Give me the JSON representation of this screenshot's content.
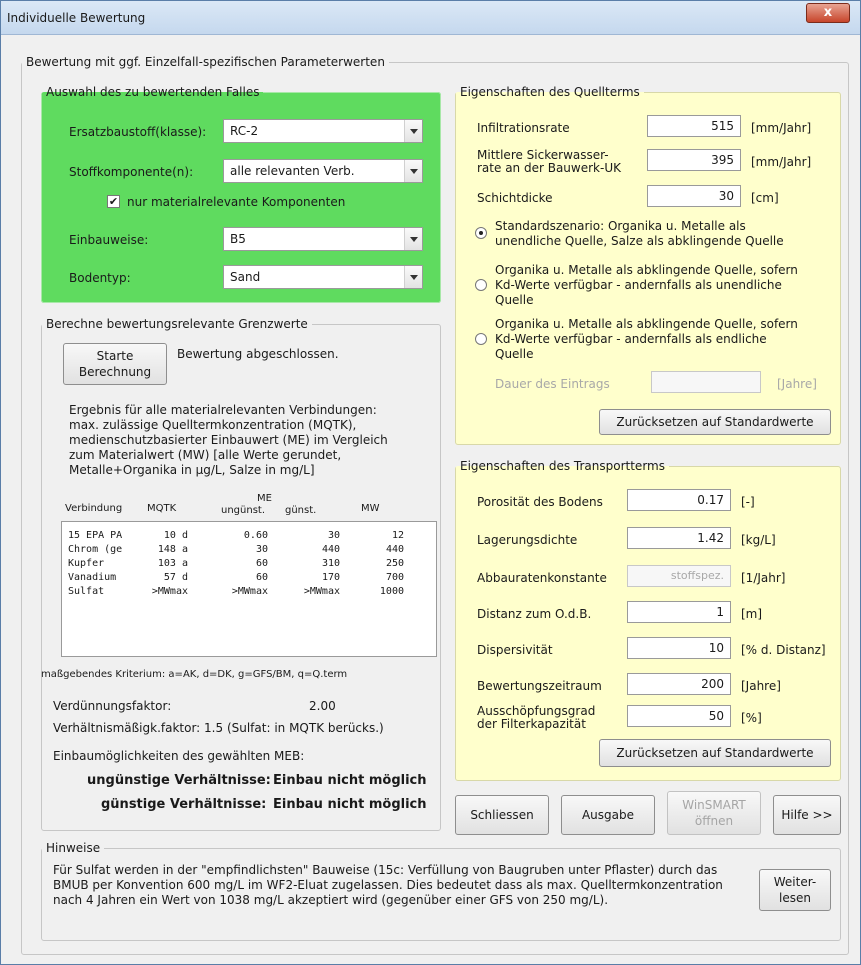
{
  "window": {
    "title": "Individuelle Bewertung",
    "close": "x"
  },
  "main_group": {
    "legend": "Bewertung mit ggf. Einzelfall-spezifischen Parameterwerten"
  },
  "case": {
    "legend": "Auswahl des zu bewertenden Falles",
    "material_label": "Ersatzbaustoff(klasse):",
    "material_value": "RC-2",
    "component_label": "Stoffkomponente(n):",
    "component_value": "alle relevanten Verb.",
    "only_relevant_label": "nur materialrelevante Komponenten",
    "only_relevant_checked": true,
    "install_label": "Einbauweise:",
    "install_value": "B5",
    "soil_label": "Bodentyp:",
    "soil_value": "Sand"
  },
  "calc": {
    "legend": "Berechne bewertungsrelevante Grenzwerte",
    "start_button": "Starte\nBerechnung",
    "status": "Bewertung abgeschlossen.",
    "result_text": [
      "Ergebnis für alle materialrelevanten Verbindungen:",
      "max. zulässige Quelltermkonzentration (MQTK),",
      "medienschutzbasierter Einbauwert (ME) im Vergleich",
      "zum Materialwert (MW) [alle Werte gerundet,",
      "Metalle+Organika in µg/L, Salze in mg/L]"
    ],
    "table_headers": {
      "verbindung": "Verbindung",
      "mqtk": "MQTK",
      "me": "ME",
      "ungunst": "ungünst.",
      "gunst": "günst.",
      "mw": "MW"
    },
    "rows": [
      {
        "name": "15 EPA PA",
        "mqtk": "10 d",
        "ungunst": "0.60",
        "gunst": "30",
        "mw": "12"
      },
      {
        "name": "Chrom (ge",
        "mqtk": "148 a",
        "ungunst": "30",
        "gunst": "440",
        "mw": "440"
      },
      {
        "name": "Kupfer",
        "mqtk": "103 a",
        "ungunst": "60",
        "gunst": "310",
        "mw": "250"
      },
      {
        "name": "Vanadium",
        "mqtk": "57 d",
        "ungunst": "60",
        "gunst": "170",
        "mw": "700"
      },
      {
        "name": "Sulfat",
        "mqtk": ">MWmax",
        "ungunst": ">MWmax",
        "gunst": ">MWmax",
        "mw": "1000"
      }
    ],
    "criterion": "maßgebendes Kriterium: a=AK, d=DK, g=GFS/BM, q=Q.term",
    "dilution_label": "Verdünnungsfaktor:",
    "dilution_value": "2.00",
    "proportionality": "Verhältnismäßigk.faktor: 1.5 (Sulfat: in MQTK berücks.)",
    "options_label": "Einbaumöglichkeiten des gewählten MEB:",
    "unfavorable_label": "ungünstige Verhältnisse:",
    "unfavorable_value": "Einbau nicht möglich",
    "favorable_label": "günstige Verhältnisse:",
    "favorable_value": "Einbau nicht möglich"
  },
  "source": {
    "legend": "Eigenschaften des Quellterms",
    "infiltration_label": "Infiltrationsrate",
    "infiltration_value": "515",
    "infiltration_unit": "[mm/Jahr]",
    "seepage_label": "Mittlere Sickerwasser-\nrate an der Bauwerk-UK",
    "seepage_value": "395",
    "seepage_unit": "[mm/Jahr]",
    "thickness_label": "Schichtdicke",
    "thickness_value": "30",
    "thickness_unit": "[cm]",
    "radio1": "Standardszenario: Organika u. Metalle als\nunendliche Quelle, Salze als abklingende Quelle",
    "radio2": "Organika u. Metalle als abklingende Quelle, sofern\nKd-Werte verfügbar - andernfalls als unendliche\nQuelle",
    "radio3": "Organika u. Metalle als abklingende Quelle, sofern\nKd-Werte verfügbar - andernfalls als endliche\nQuelle",
    "duration_label": "Dauer des Eintrags",
    "duration_unit": "[Jahre]",
    "reset_button": "Zurücksetzen auf Standardwerte"
  },
  "transport": {
    "legend": "Eigenschaften des Transportterms",
    "porosity_label": "Porosität des Bodens",
    "porosity_value": "0.17",
    "porosity_unit": "[-]",
    "density_label": "Lagerungsdichte",
    "density_value": "1.42",
    "density_unit": "[kg/L]",
    "decay_label": "Abbauratenkonstante",
    "decay_value": "stoffspez.",
    "decay_unit": "[1/Jahr]",
    "distance_label": "Distanz zum O.d.B.",
    "distance_value": "1",
    "distance_unit": "[m]",
    "dispersivity_label": "Dispersivität",
    "dispersivity_value": "10",
    "dispersivity_unit": "[% d. Distanz]",
    "period_label": "Bewertungszeitraum",
    "period_value": "200",
    "period_unit": "[Jahre]",
    "exhaustion_label": "Ausschöpfungsgrad\nder Filterkapazität",
    "exhaustion_value": "50",
    "exhaustion_unit": "[%]",
    "reset_button": "Zurücksetzen auf Standardwerte"
  },
  "actions": {
    "close": "Schliessen",
    "output": "Ausgabe",
    "winsmart": "WinSMART\nöffnen",
    "help": "Hilfe >>"
  },
  "notes": {
    "legend": "Hinweise",
    "text": "Für Sulfat werden in der \"empfindlichsten\" Bauweise (15c: Verfüllung von Baugruben unter Pflaster) durch das BMUB per Konvention 600 mg/L im WF2-Eluat zugelassen. Dies bedeutet dass als max. Quelltermkonzentration nach 4 Jahren ein Wert von 1038 mg/L akzeptiert wird (gegenüber einer GFS von 250 mg/L).",
    "more_button": "Weiter-\nlesen"
  },
  "colors": {
    "green_panel": "#5fdb5f",
    "yellow_panel": "#ffffcc"
  }
}
